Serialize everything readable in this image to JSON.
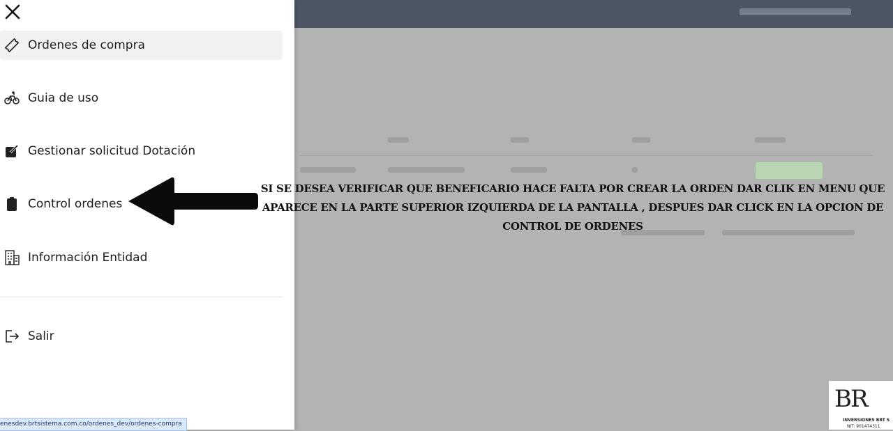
{
  "menu": {
    "items": [
      {
        "label": "Ordenes de compra",
        "icon": "ticket-icon",
        "active": true
      },
      {
        "label": "Guia de uso",
        "icon": "bicycle-icon",
        "active": false
      },
      {
        "label": "Gestionar solicitud Dotación",
        "icon": "edit-square-icon",
        "active": false
      },
      {
        "label": "Control ordenes",
        "icon": "clipboard-icon",
        "active": false
      },
      {
        "label": "Información Entidad",
        "icon": "building-icon",
        "active": false
      }
    ],
    "logout": {
      "label": "Salir",
      "icon": "logout-icon"
    }
  },
  "status_url": "enesdev.brtsistema.com.co/ordenes_dev/ordenes-compra",
  "annotation": {
    "text": "SI SE DESEA VERIFICAR QUE BENEFICARIO HACE FALTA POR CREAR LA ORDEN DAR CLIK EN MENU QUE APARECE EN LA PARTE SUPERIOR IZQUIERDA DE LA PANTALLA , DESPUES DAR CLICK  EN LA OPCION DE CONTROL DE ORDENES"
  },
  "logo": {
    "text": "BR",
    "subtitle": "INVERSIONES BRT S",
    "nit": "NIT: 901474311"
  },
  "colors": {
    "drawer_bg": "#ffffff",
    "overlay": "#b3b3b3",
    "active_item": "#f2f2f2",
    "topbar": "#4b5563"
  }
}
